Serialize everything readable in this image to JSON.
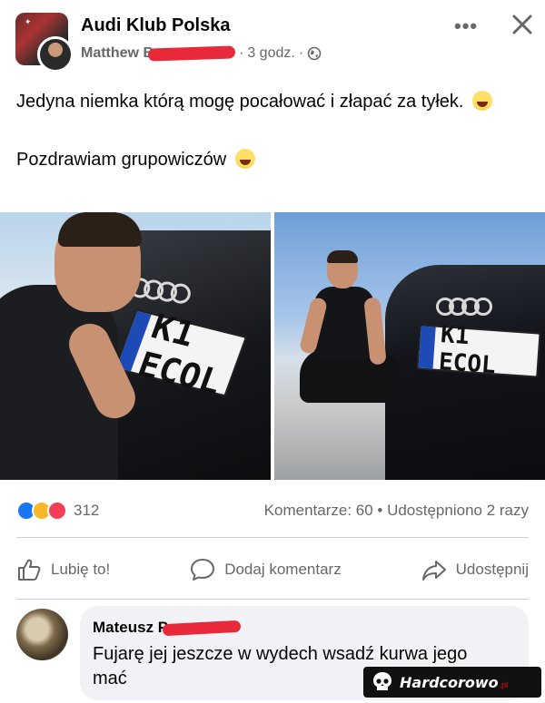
{
  "header": {
    "group_name": "Audi Klub Polska",
    "author_name": "Matthew B",
    "time": "3 godz.",
    "separator": "·",
    "privacy_icon": "globe-icon",
    "more_icon": "more-horizontal-icon",
    "more_label": "•••",
    "close_icon": "close-icon"
  },
  "post": {
    "line1": "Jedyna niemka którą mogę pocałować i złapać za tyłek.",
    "line1_emoji": "laughing-tears-emoji",
    "line2": "Pozdrawiam grupowiczów",
    "line2_emoji": "tongue-out-emoji"
  },
  "photos": {
    "left_plate": "K1 ECOL",
    "right_plate": "K1 ECOL"
  },
  "stats": {
    "reaction_icons": [
      "like-icon",
      "haha-icon",
      "love-icon"
    ],
    "reaction_count": "312",
    "comments_shares": "Komentarze: 60 • Udostępniono 2 razy"
  },
  "actions": {
    "like": "Lubię to!",
    "comment": "Dodaj komentarz",
    "share": "Udostępnij"
  },
  "comment": {
    "author": "Mateusz P",
    "text": "Fujarę jej jeszcze w wydech wsadź kurwa jego mać"
  },
  "watermark": {
    "text": "Hardcorowo",
    "tld": ".pl"
  },
  "colors": {
    "accent": "#1877f2",
    "redaction": "#e8293a",
    "secondary_text": "#65676b",
    "bubble": "#f0f2f5"
  }
}
